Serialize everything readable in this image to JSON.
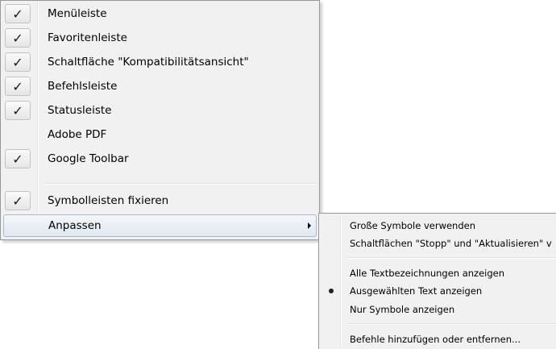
{
  "menu": {
    "items": [
      {
        "label": "Menüleiste",
        "checked": true
      },
      {
        "label": "Favoritenleiste",
        "checked": true
      },
      {
        "label": "Schaltfläche \"Kompatibilitätsansicht\"",
        "checked": true
      },
      {
        "label": "Befehlsleiste",
        "checked": true
      },
      {
        "label": "Statusleiste",
        "checked": true
      },
      {
        "label": "Adobe PDF",
        "checked": false
      },
      {
        "label": "Google Toolbar",
        "checked": true
      },
      {
        "label": "Symbolleisten fixieren",
        "checked": true
      },
      {
        "label": "Anpassen",
        "checked": false,
        "has_submenu": true,
        "highlighted": true
      }
    ],
    "check_glyph": "✓"
  },
  "submenu": {
    "items": [
      {
        "label": "Große Symbole verwenden",
        "selected": false
      },
      {
        "label": "Schaltflächen \"Stopp\" und \"Aktualisieren\" v",
        "selected": false
      },
      {
        "label": "Alle Textbezeichnungen anzeigen",
        "selected": false
      },
      {
        "label": "Ausgewählten Text anzeigen",
        "selected": true
      },
      {
        "label": "Nur Symbole anzeigen",
        "selected": false
      },
      {
        "label": "Befehle hinzufügen oder entfernen...",
        "selected": false
      }
    ]
  },
  "colors": {
    "menu_background": "#f1f1f1",
    "menu_border": "#979797",
    "highlight_border": "#a8b9cf"
  }
}
